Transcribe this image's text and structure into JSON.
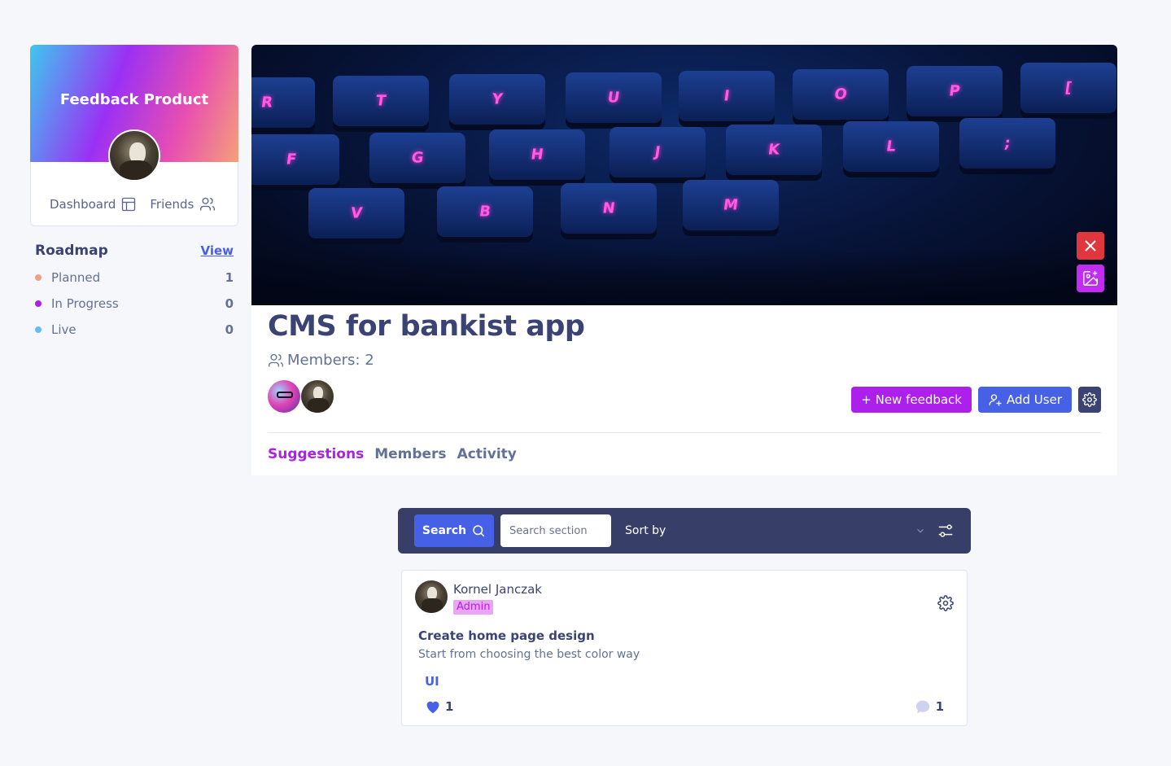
{
  "profile": {
    "title": "Feedback Product",
    "links": [
      {
        "label": "Dashboard",
        "icon": "layout-icon"
      },
      {
        "label": "Friends",
        "icon": "users-icon"
      }
    ]
  },
  "roadmap": {
    "title": "Roadmap",
    "view_label": "View",
    "items": [
      {
        "label": "Planned",
        "count": "1",
        "color": "#f49f85"
      },
      {
        "label": "In Progress",
        "count": "0",
        "color": "#ad1fea"
      },
      {
        "label": "Live",
        "count": "0",
        "color": "#62bcfa"
      }
    ]
  },
  "hero": {
    "keys": [
      "R",
      "T",
      "Y",
      "U",
      "I",
      "O",
      "P",
      "[",
      "F",
      "G",
      "H",
      "J",
      "K",
      "L",
      ";",
      "V",
      "B",
      "N",
      "M"
    ],
    "close_icon": "close-icon",
    "image_icon": "image-add-icon",
    "colors": {
      "close": "#e0373f",
      "image": "#c12df0"
    }
  },
  "project": {
    "title": "CMS for bankist app",
    "members_label": "Members: 2",
    "actions": {
      "new_feedback": "+ New feedback",
      "add_user": "Add User"
    },
    "tabs": [
      "Suggestions",
      "Members",
      "Activity"
    ],
    "active_tab": "Suggestions"
  },
  "search": {
    "button_label": "Search",
    "input_placeholder": "Search section",
    "sort_label": "Sort by"
  },
  "feedback": {
    "author": "Kornel Janczak",
    "role": "Admin",
    "title": "Create home page design",
    "description": "Start from choosing the best color way",
    "tag": "UI",
    "likes": "1",
    "comments": "1"
  },
  "colors": {
    "accent_purple": "#ad1fea",
    "accent_blue": "#4661e6",
    "dark_navy": "#3a4374",
    "searchbar": "#373f68"
  }
}
